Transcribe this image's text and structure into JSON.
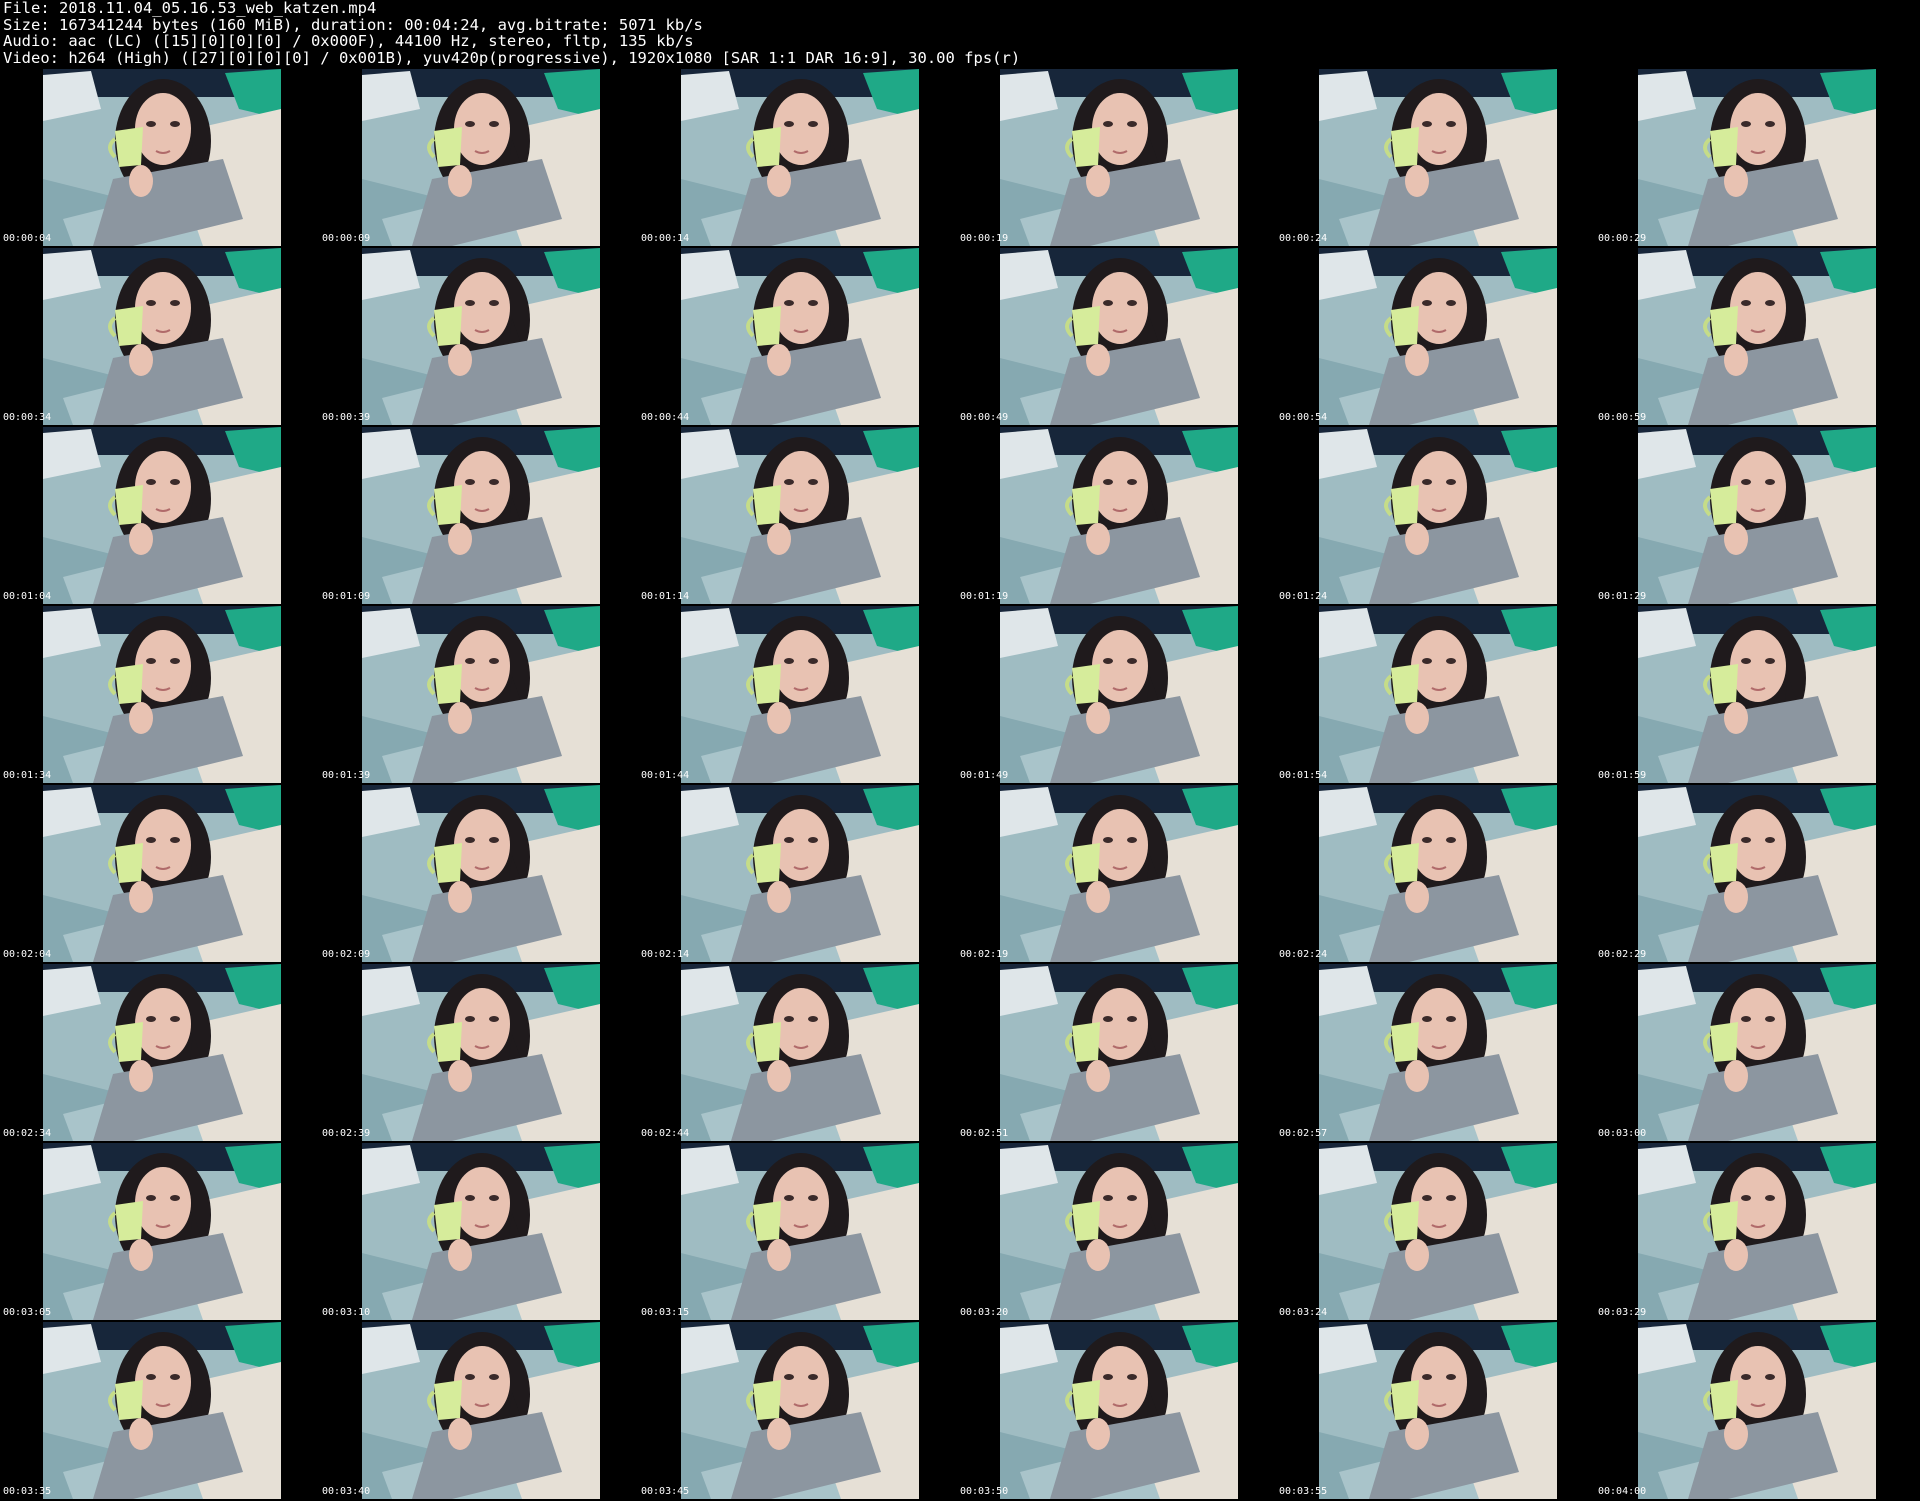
{
  "header": {
    "lines": [
      "File: 2018.11.04_05.16.53_web_katzen.mp4",
      "Size: 167341244 bytes (160 MiB), duration: 00:04:24, avg.bitrate: 5071 kb/s",
      "Audio: aac (LC) ([15][0][0][0] / 0x000F), 44100 Hz, stereo, fltp, 135 kb/s",
      "Video: h264 (High) ([27][0][0][0] / 0x001B), yuv420p(progressive), 1920x1080 [SAR 1:1 DAR 16:9], 30.00 fps(r)"
    ]
  },
  "colors": {
    "background": "#000000",
    "text": "#ffffff",
    "bed_blue": "#9fbcc2",
    "pillow_green": "#1fa987",
    "pillow_white": "#dfe6e9",
    "wall_dark": "#17263a",
    "hair": "#1f1a1c",
    "skin": "#e8c2b2",
    "sleeve_grey": "#8c96a0",
    "mug_green": "#d6ec9b",
    "sheet_cream": "#e6e0d6"
  },
  "thumbnails": [
    {
      "timestamp": "00:00:04",
      "icon": "video-frame-thumbnail"
    },
    {
      "timestamp": "00:00:09",
      "icon": "video-frame-thumbnail"
    },
    {
      "timestamp": "00:00:14",
      "icon": "video-frame-thumbnail"
    },
    {
      "timestamp": "00:00:19",
      "icon": "video-frame-thumbnail"
    },
    {
      "timestamp": "00:00:24",
      "icon": "video-frame-thumbnail"
    },
    {
      "timestamp": "00:00:29",
      "icon": "video-frame-thumbnail"
    },
    {
      "timestamp": "00:00:34",
      "icon": "video-frame-thumbnail"
    },
    {
      "timestamp": "00:00:39",
      "icon": "video-frame-thumbnail"
    },
    {
      "timestamp": "00:00:44",
      "icon": "video-frame-thumbnail"
    },
    {
      "timestamp": "00:00:49",
      "icon": "video-frame-thumbnail"
    },
    {
      "timestamp": "00:00:54",
      "icon": "video-frame-thumbnail"
    },
    {
      "timestamp": "00:00:59",
      "icon": "video-frame-thumbnail"
    },
    {
      "timestamp": "00:01:04",
      "icon": "video-frame-thumbnail"
    },
    {
      "timestamp": "00:01:09",
      "icon": "video-frame-thumbnail"
    },
    {
      "timestamp": "00:01:14",
      "icon": "video-frame-thumbnail"
    },
    {
      "timestamp": "00:01:19",
      "icon": "video-frame-thumbnail"
    },
    {
      "timestamp": "00:01:24",
      "icon": "video-frame-thumbnail"
    },
    {
      "timestamp": "00:01:29",
      "icon": "video-frame-thumbnail"
    },
    {
      "timestamp": "00:01:34",
      "icon": "video-frame-thumbnail"
    },
    {
      "timestamp": "00:01:39",
      "icon": "video-frame-thumbnail"
    },
    {
      "timestamp": "00:01:44",
      "icon": "video-frame-thumbnail"
    },
    {
      "timestamp": "00:01:49",
      "icon": "video-frame-thumbnail"
    },
    {
      "timestamp": "00:01:54",
      "icon": "video-frame-thumbnail"
    },
    {
      "timestamp": "00:01:59",
      "icon": "video-frame-thumbnail"
    },
    {
      "timestamp": "00:02:04",
      "icon": "video-frame-thumbnail"
    },
    {
      "timestamp": "00:02:09",
      "icon": "video-frame-thumbnail"
    },
    {
      "timestamp": "00:02:14",
      "icon": "video-frame-thumbnail"
    },
    {
      "timestamp": "00:02:19",
      "icon": "video-frame-thumbnail"
    },
    {
      "timestamp": "00:02:24",
      "icon": "video-frame-thumbnail"
    },
    {
      "timestamp": "00:02:29",
      "icon": "video-frame-thumbnail"
    },
    {
      "timestamp": "00:02:34",
      "icon": "video-frame-thumbnail"
    },
    {
      "timestamp": "00:02:39",
      "icon": "video-frame-thumbnail"
    },
    {
      "timestamp": "00:02:44",
      "icon": "video-frame-thumbnail"
    },
    {
      "timestamp": "00:02:51",
      "icon": "video-frame-thumbnail"
    },
    {
      "timestamp": "00:02:57",
      "icon": "video-frame-thumbnail"
    },
    {
      "timestamp": "00:03:00",
      "icon": "video-frame-thumbnail"
    },
    {
      "timestamp": "00:03:05",
      "icon": "video-frame-thumbnail"
    },
    {
      "timestamp": "00:03:10",
      "icon": "video-frame-thumbnail"
    },
    {
      "timestamp": "00:03:15",
      "icon": "video-frame-thumbnail"
    },
    {
      "timestamp": "00:03:20",
      "icon": "video-frame-thumbnail"
    },
    {
      "timestamp": "00:03:24",
      "icon": "video-frame-thumbnail"
    },
    {
      "timestamp": "00:03:29",
      "icon": "video-frame-thumbnail"
    },
    {
      "timestamp": "00:03:35",
      "icon": "video-frame-thumbnail"
    },
    {
      "timestamp": "00:03:40",
      "icon": "video-frame-thumbnail"
    },
    {
      "timestamp": "00:03:45",
      "icon": "video-frame-thumbnail"
    },
    {
      "timestamp": "00:03:50",
      "icon": "video-frame-thumbnail"
    },
    {
      "timestamp": "00:03:55",
      "icon": "video-frame-thumbnail"
    },
    {
      "timestamp": "00:04:00",
      "icon": "video-frame-thumbnail"
    }
  ]
}
